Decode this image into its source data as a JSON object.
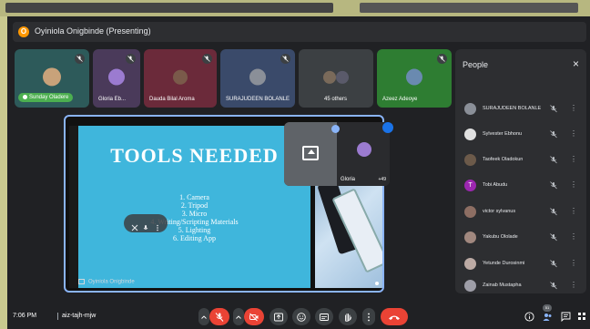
{
  "meeting": {
    "presenting_title": "Oyiniola Onigbinde (Presenting)",
    "presenter_initial": "O",
    "time": "7:06 PM",
    "meeting_code": "aiz-tajh-mjw"
  },
  "tiles": [
    {
      "name": "Sunday Oladere",
      "speaking": true
    },
    {
      "name": "Gloria Eb..."
    },
    {
      "name": "Dauda Bilal Aroma"
    },
    {
      "name": "SURAJUDEEN BOLANLE"
    },
    {
      "name": "45 others"
    },
    {
      "name": "Azeez Adeoye"
    }
  ],
  "slide": {
    "title": "TOOLS NEEDED",
    "items": [
      "1. Camera",
      "2. Tripod",
      "3. Micro",
      "4. Writing/Scripting Materials",
      "5. Lighting",
      "6. Editing App"
    ]
  },
  "stage": {
    "presenter_label": "Oyiniola Onigbinde"
  },
  "floating": {
    "cam_name": "Gloria",
    "extra_count": "+49"
  },
  "people": {
    "title": "People",
    "close": "×",
    "list": [
      {
        "name": "SURAJUDEEN BOLANLE",
        "color": "#8a8f98"
      },
      {
        "name": "Sylvester Ebhonu",
        "color": "#e0e0e0"
      },
      {
        "name": "Taofeek Oladokun",
        "color": "#6c5a4a"
      },
      {
        "name": "Tobi Abudu",
        "color": "#9c27b0",
        "initial": "T"
      },
      {
        "name": "victor sylvanus",
        "color": "#8d6e63"
      },
      {
        "name": "Yakubu Ololade",
        "color": "#a1887f"
      },
      {
        "name": "Yetunde Durosinmi",
        "color": "#bcaaa4"
      },
      {
        "name": "Zainab Mustapha",
        "color": "#9e9ea8"
      }
    ],
    "more_icon": "⋮"
  },
  "controls": {
    "participants_count": "51"
  },
  "colors": {
    "accent": "#8ab4f8",
    "end_call": "#ea4335",
    "speaking": "#4caf50"
  }
}
